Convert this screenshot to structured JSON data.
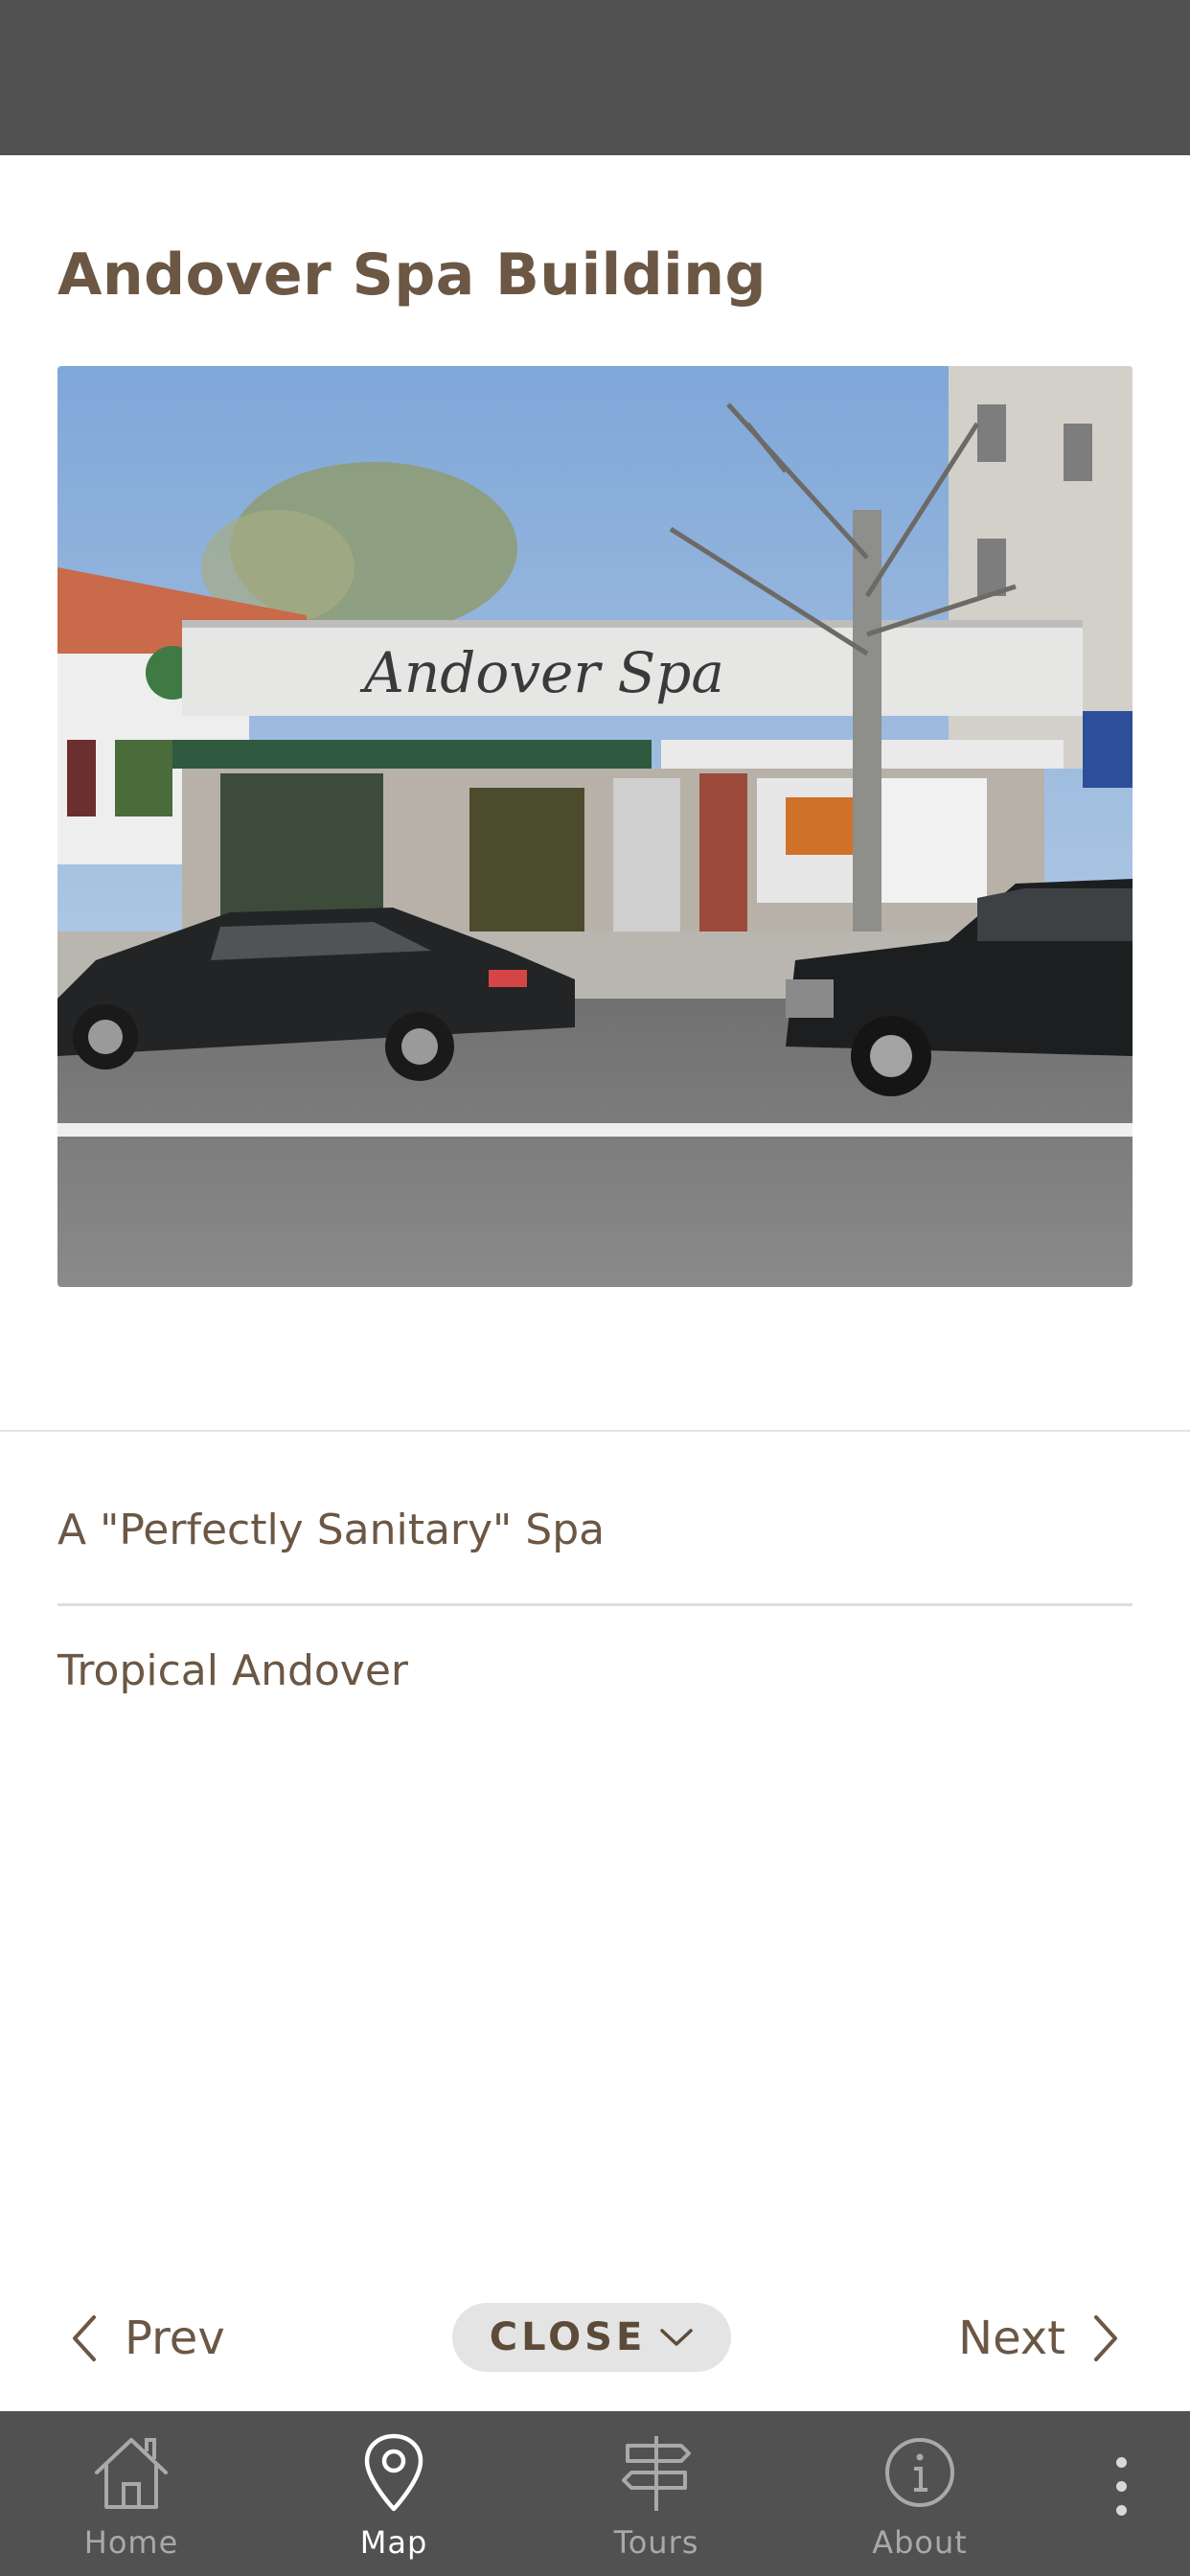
{
  "page": {
    "title": "Andover Spa Building"
  },
  "photo": {
    "sign_text": "Andover Spa",
    "alt": "Street view photo"
  },
  "stories": [
    {
      "label": "A \"Perfectly Sanitary\" Spa"
    },
    {
      "label": "Tropical Andover"
    }
  ],
  "pager": {
    "prev_label": "Prev",
    "close_label": "CLOSE",
    "next_label": "Next"
  },
  "tabs": [
    {
      "label": "Home",
      "icon": "home-icon"
    },
    {
      "label": "Map",
      "icon": "map-pin-icon",
      "active": true
    },
    {
      "label": "Tours",
      "icon": "signpost-icon"
    },
    {
      "label": "About",
      "icon": "info-icon"
    }
  ],
  "colors": {
    "bars": "#515151",
    "text": "#6b5744",
    "tab_inactive": "#a9a9a9",
    "tab_active": "#ffffff",
    "close_pill": "#e4e4e4"
  }
}
